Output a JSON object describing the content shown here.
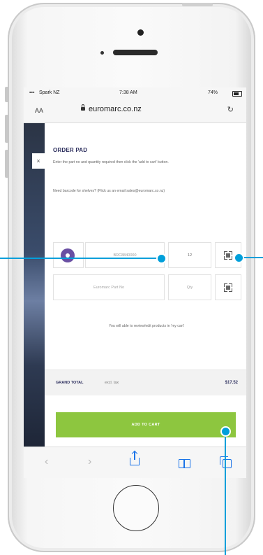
{
  "status_bar": {
    "carrier": "Spark NZ",
    "time": "7:38 AM",
    "battery": "74%"
  },
  "browser": {
    "text_size_label": "AA",
    "url": "euromarc.co.nz",
    "reload_icon": "reload-icon"
  },
  "order_pad": {
    "title": "ORDER PAD",
    "description": "Enter the part no and quantity required then click the 'add to cart' button.",
    "help_text": "Need barcode for shelves? (Flick us an email sales@euromarc.co.nz)",
    "rows": [
      {
        "part_no": "BRC8840000",
        "qty": "12"
      },
      {
        "part_placeholder": "Euromarc Part No",
        "qty_placeholder": "Qty"
      }
    ],
    "notice": "You will able to review/edit products in 'my cart'",
    "total": {
      "label": "GRAND TOTAL",
      "tax_label": "excl. tax",
      "amount": "$17.52"
    },
    "add_button": "ADD TO CART",
    "close_label": "×"
  },
  "toolbar": {
    "back": "‹",
    "forward": "›"
  },
  "colors": {
    "accent_green": "#8dc63f",
    "brand_navy": "#2d2f5e",
    "callout_blue": "#009fda",
    "avatar_purple": "#6a4fa3"
  }
}
